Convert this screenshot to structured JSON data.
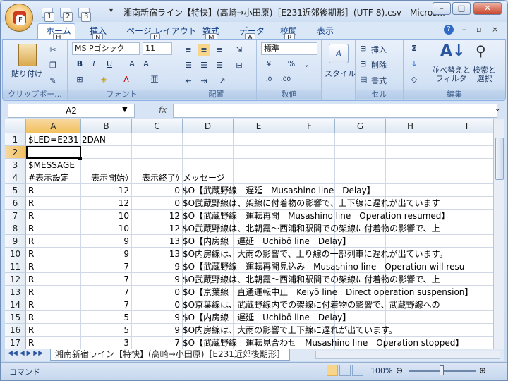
{
  "window": {
    "title": "湘南新宿ライン【特快】(高崎→小田原)［E231近郊後期形］(UTF-8).csv - Micros...",
    "office_key": "F",
    "qat_keys": [
      "1",
      "2",
      "3"
    ],
    "minimize": "–",
    "restore": "□",
    "close": "✕"
  },
  "tabs": [
    {
      "label": "ホーム",
      "key": "H"
    },
    {
      "label": "挿入",
      "key": "N"
    },
    {
      "label": "ページ レイアウト",
      "key": "P"
    },
    {
      "label": "数式",
      "key": "M"
    },
    {
      "label": "データ",
      "key": "A"
    },
    {
      "label": "校閲",
      "key": "R"
    },
    {
      "label": "表示",
      "key": ""
    }
  ],
  "ribbon": {
    "clipboard": {
      "label": "クリップボー...",
      "paste": "貼り付け"
    },
    "font": {
      "label": "フォント",
      "name": "MS Pゴシック",
      "size": "11"
    },
    "alignment": {
      "label": "配置"
    },
    "number": {
      "label": "数値",
      "format": "標準"
    },
    "style": {
      "label": "スタイル"
    },
    "cells": {
      "label": "セル",
      "insert": "挿入",
      "delete": "削除",
      "format": "書式"
    },
    "editing": {
      "label": "編集",
      "sort": "並べ替えと\nフィルタ",
      "find": "検索と\n選択"
    }
  },
  "namebox": "A2",
  "fx": "fx",
  "columns": [
    "A",
    "B",
    "C",
    "D",
    "E",
    "F",
    "G",
    "H",
    "I"
  ],
  "rows": [
    {
      "n": "1",
      "a": "$LED=E231-2DAN",
      "b": "",
      "c": "",
      "d": ""
    },
    {
      "n": "2",
      "a": "",
      "b": "",
      "c": "",
      "d": ""
    },
    {
      "n": "3",
      "a": "$MESSAGE",
      "b": "",
      "c": "",
      "d": ""
    },
    {
      "n": "4",
      "a": "#表示設定",
      "b": "表示開始ｹ",
      "c": "表示終了ｹ",
      "d": "メッセージ"
    },
    {
      "n": "5",
      "a": "R",
      "b": "12",
      "c": "0",
      "d": "$O【武蔵野線　遅延　Musashino line　Delay】"
    },
    {
      "n": "6",
      "a": "R",
      "b": "12",
      "c": "0",
      "d": "$O武蔵野線は、架線に付着物の影響で、上下線に遅れが出ています"
    },
    {
      "n": "7",
      "a": "R",
      "b": "10",
      "c": "12",
      "d": "$O【武蔵野線　運転再開　Musashino line　Operation resumed】"
    },
    {
      "n": "8",
      "a": "R",
      "b": "10",
      "c": "12",
      "d": "$O武蔵野線は、北朝霞～西浦和駅間での架線に付着物の影響で、上"
    },
    {
      "n": "9",
      "a": "R",
      "b": "9",
      "c": "13",
      "d": "$O【内房線　遅延　Uchibō line　Delay】"
    },
    {
      "n": "10",
      "a": "R",
      "b": "9",
      "c": "13",
      "d": "$O内房線は、大雨の影響で、上り線の一部列車に遅れが出ています。"
    },
    {
      "n": "11",
      "a": "R",
      "b": "7",
      "c": "9",
      "d": "$O【武蔵野線　運転再開見込み　Musashino line　Operation will resu"
    },
    {
      "n": "12",
      "a": "R",
      "b": "7",
      "c": "9",
      "d": "$O武蔵野線は、北朝霞～西浦和駅間での架線に付着物の影響で、上"
    },
    {
      "n": "13",
      "a": "R",
      "b": "7",
      "c": "0",
      "d": "$O【京葉線　直通運転中止　Keiyō line　Direct operation suspension】"
    },
    {
      "n": "14",
      "a": "R",
      "b": "7",
      "c": "0",
      "d": "$O京葉線は、武蔵野線内での架線に付着物の影響で、武蔵野線への"
    },
    {
      "n": "15",
      "a": "R",
      "b": "5",
      "c": "9",
      "d": "$O【内房線　遅延　Uchibō line　Delay】"
    },
    {
      "n": "16",
      "a": "R",
      "b": "5",
      "c": "9",
      "d": "$O内房線は、大雨の影響で上下線に遅れが出ています。"
    },
    {
      "n": "17",
      "a": "R",
      "b": "3",
      "c": "7",
      "d": "$O【武蔵野線　運転見合わせ　Musashino line　Operation stopped】"
    }
  ],
  "sheet_tab": "湘南新宿ライン【特快】(高崎→小田原)［E231近郊後期形］",
  "status": {
    "mode": "コマンド",
    "zoom": "100%"
  }
}
